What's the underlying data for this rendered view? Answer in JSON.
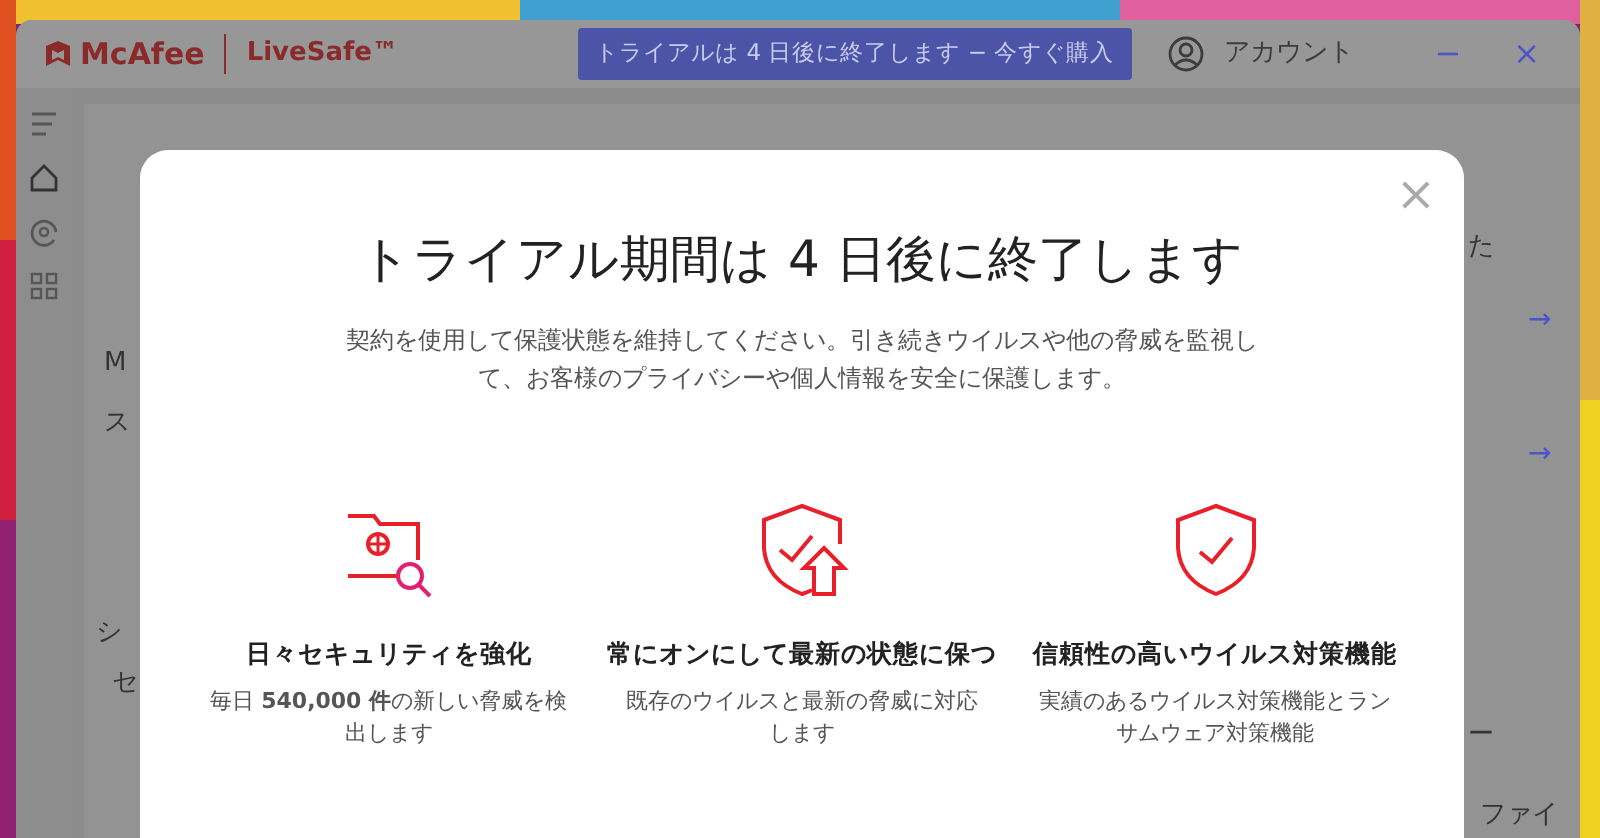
{
  "app": {
    "brand": "McAfee",
    "product": "LiveSafe™",
    "trial_button": "トライアルは 4 日後に終了します − 今すぐ購入",
    "account": "アカウント",
    "minimize": "−",
    "close": "×"
  },
  "sidebar": {
    "items": [
      {
        "kind": "menu",
        "selected": false
      },
      {
        "kind": "home",
        "selected": true
      },
      {
        "kind": "protection",
        "selected": false
      },
      {
        "kind": "apps",
        "selected": false
      }
    ]
  },
  "background": {
    "left_fragments": [
      "M",
      "ス"
    ],
    "section_fragments": [
      "シ",
      "セ"
    ],
    "right_fragments": [
      "た",
      "ー",
      "ファイ"
    ],
    "arrows": [
      "→",
      "→"
    ]
  },
  "dialog": {
    "close": "×",
    "title": "トライアル期間は 4 日後に終了します",
    "message": "契約を使用して保護状態を維持してください。引き続きウイルスや他の脅威を監視して、お客様のプライバシーや個人情報を安全に保護します。",
    "features": [
      {
        "kind": "scan",
        "title": "日々セキュリティを強化",
        "text": "毎日 **540,000 件**の新しい脅威を検出します"
      },
      {
        "kind": "update",
        "title": "常にオンにして最新の状態に保つ",
        "text": "既存のウイルスと最新の脅威に対応します"
      },
      {
        "kind": "shield",
        "title": "信頼性の高いウイルス対策機能",
        "text": "実績のあるウイルス対策機能とランサムウェア対策機能"
      }
    ]
  }
}
